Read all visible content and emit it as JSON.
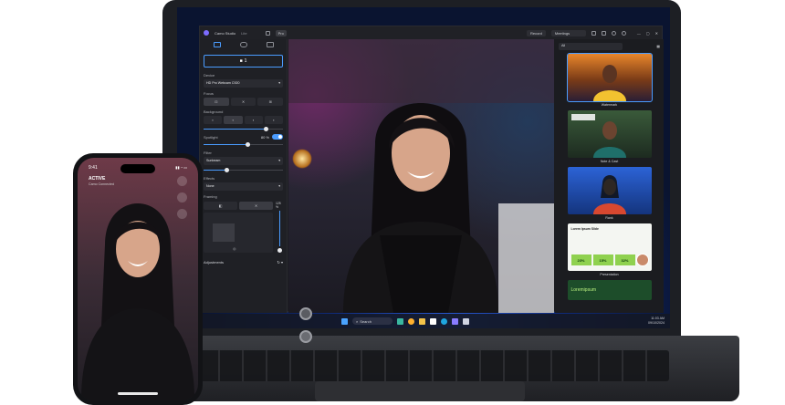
{
  "app": {
    "title": "Camo Studio",
    "edition": "Lite",
    "badge": "Pro",
    "record_label": "Record",
    "meetings_label": "Meetings"
  },
  "panel": {
    "camera_button": "1",
    "device_label": "Device",
    "device_value": "HD Pro Webcam C920",
    "focus_label": "Focus",
    "background_label": "Background",
    "spotlight_label": "Spotlight",
    "spotlight_value": "80 %",
    "filter_label": "Filter",
    "filter_value": "Sunbeam",
    "effects_label": "Effects",
    "effects_value": "None",
    "framing_label": "Framing",
    "zoom_value": "125 %",
    "adjustments_label": "Adjustments"
  },
  "previews": {
    "selector_value": "All",
    "items": [
      {
        "caption": "Watermark"
      },
      {
        "caption": "Note & Cast"
      },
      {
        "caption": "Rank"
      },
      {
        "caption": "Presentation"
      }
    ],
    "slide_title": "Lorem Ipsum Slide",
    "slide_stats": [
      "23%",
      "15%",
      "32%"
    ],
    "green_card_text": "Loremipsum"
  },
  "taskbar": {
    "search_placeholder": "Search",
    "time": "11:03 AM",
    "date": "09/10/2024"
  },
  "phone": {
    "time": "9:41",
    "status": "ACTIVE",
    "subtitle": "Camo Connected"
  },
  "colors": {
    "accent": "#4a9cff",
    "app_bg": "#1b1c20",
    "stat_green": "#8fd14f"
  }
}
